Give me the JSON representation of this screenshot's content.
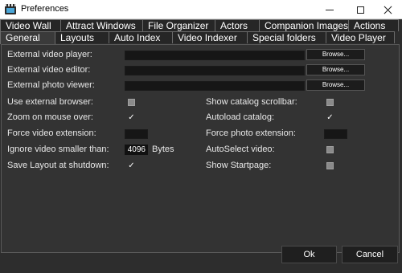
{
  "window": {
    "title": "Preferences"
  },
  "tabs": {
    "row1": [
      "Video Wall",
      "Attract Windows",
      "File Organizer",
      "Actors",
      "Companion Images",
      "Actions"
    ],
    "row2": [
      "General",
      "Layouts",
      "Auto Index",
      "Video Indexer",
      "Special folders",
      "Video Player"
    ],
    "active": "General"
  },
  "general": {
    "external_video_player": {
      "label": "External video player:",
      "value": "",
      "browse": "Browse..."
    },
    "external_video_editor": {
      "label": "External video editor:",
      "value": "",
      "browse": "Browse..."
    },
    "external_photo_viewer": {
      "label": "External photo viewer:",
      "value": "",
      "browse": "Browse..."
    },
    "use_external_browser": {
      "label": "Use external browser:",
      "checked": false
    },
    "zoom_on_mouse_over": {
      "label": "Zoom on mouse over:",
      "checked": true
    },
    "force_video_extension": {
      "label": "Force video extension:",
      "value": ""
    },
    "ignore_video_smaller_than": {
      "label": "Ignore video smaller than:",
      "value": "4096",
      "unit": "Bytes"
    },
    "save_layout_at_shutdown": {
      "label": "Save Layout at shutdown:",
      "checked": true
    },
    "show_catalog_scrollbar": {
      "label": "Show catalog scrollbar:",
      "checked": false
    },
    "autoload_catalog": {
      "label": "Autoload catalog:",
      "checked": true
    },
    "force_photo_extension": {
      "label": "Force photo extension:",
      "value": ""
    },
    "autoselect_video": {
      "label": "AutoSelect video:",
      "checked": false
    },
    "show_startpage": {
      "label": "Show Startpage:",
      "checked": false
    }
  },
  "buttons": {
    "ok": "Ok",
    "cancel": "Cancel"
  }
}
